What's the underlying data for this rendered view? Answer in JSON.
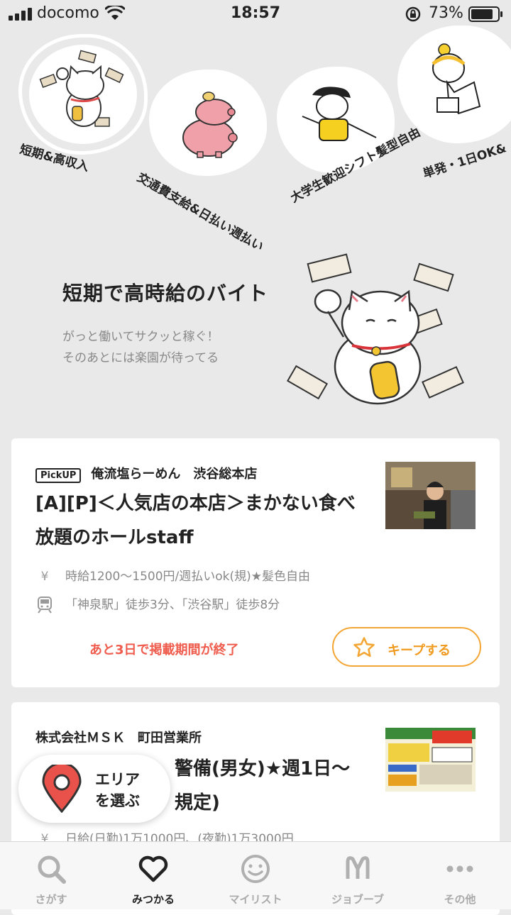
{
  "status_bar": {
    "carrier": "docomo",
    "time": "18:57",
    "battery": "73%"
  },
  "categories": [
    {
      "label": "短期&高収入",
      "selected": true
    },
    {
      "label": "交通費支給&日払い週払い",
      "selected": false
    },
    {
      "label": "大学生歓迎シフト髪型自由",
      "selected": false
    },
    {
      "label": "単発・1日OK&",
      "selected": false
    }
  ],
  "hero": {
    "title": "短期で高時給のバイト",
    "subtitle_line1": "がっと働いてサクッと稼ぐ！",
    "subtitle_line2": "そのあとには楽園が待ってる"
  },
  "jobs": [
    {
      "badge": "PickUP",
      "company": "俺流塩らーめん　渋谷総本店",
      "title": "[A][P]＜人気店の本店＞まかない食べ放題のホールstaff",
      "wage": "時給1200〜1500円/週払いok(規)★髪色自由",
      "access": "「神泉駅」徒歩3分、「渋谷駅」徒歩8分",
      "expire_note": "あと3日で掲載期間が終了",
      "keep_label": "キープする"
    },
    {
      "company": "株式会社ＭＳＫ　町田営業所",
      "title_visible": "警備(男女)★週1日〜",
      "title_line2_visible": "規定)",
      "wage": "日給(日勤)1万1000円、(夜勤)1万3000円"
    }
  ],
  "area_button": {
    "line1": "エリア",
    "line2": "を選ぶ"
  },
  "tabs": [
    {
      "label": "さがす",
      "icon": "search-icon",
      "active": false
    },
    {
      "label": "みつかる",
      "icon": "heart-icon",
      "active": true
    },
    {
      "label": "マイリスト",
      "icon": "smiley-icon",
      "active": false
    },
    {
      "label": "ジョブーブ",
      "icon": "jobuub-icon",
      "active": false
    },
    {
      "label": "その他",
      "icon": "more-icon",
      "active": false
    }
  ],
  "colors": {
    "accent_orange": "#f4a634",
    "alert_red": "#ef5b4c",
    "map_pin_red": "#e8524a"
  }
}
